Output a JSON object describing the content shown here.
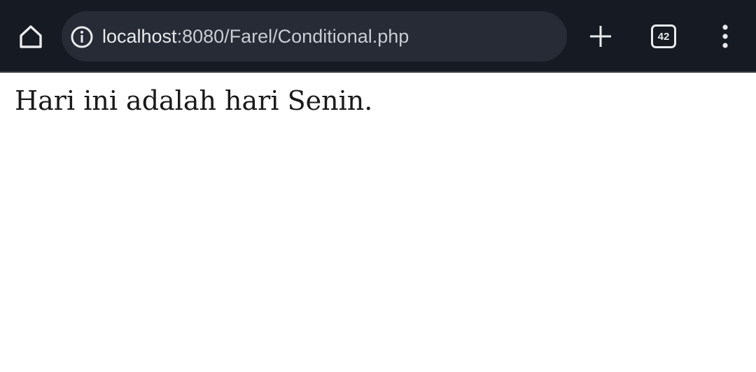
{
  "browser": {
    "url_host": "localhost",
    "url_path": ":8080/Farel/Conditional.php",
    "tab_count": "42",
    "icons": {
      "home": "home-icon",
      "site_info": "info-icon",
      "new_tab": "plus-icon",
      "tabs": "tab-switcher-icon",
      "menu": "kebab-menu-icon"
    },
    "colors": {
      "toolbar_bg": "#161a22",
      "omnibox_bg": "#262b35",
      "icon_fg": "#e8eaee"
    }
  },
  "page": {
    "text": "Hari ini adalah hari Senin."
  }
}
